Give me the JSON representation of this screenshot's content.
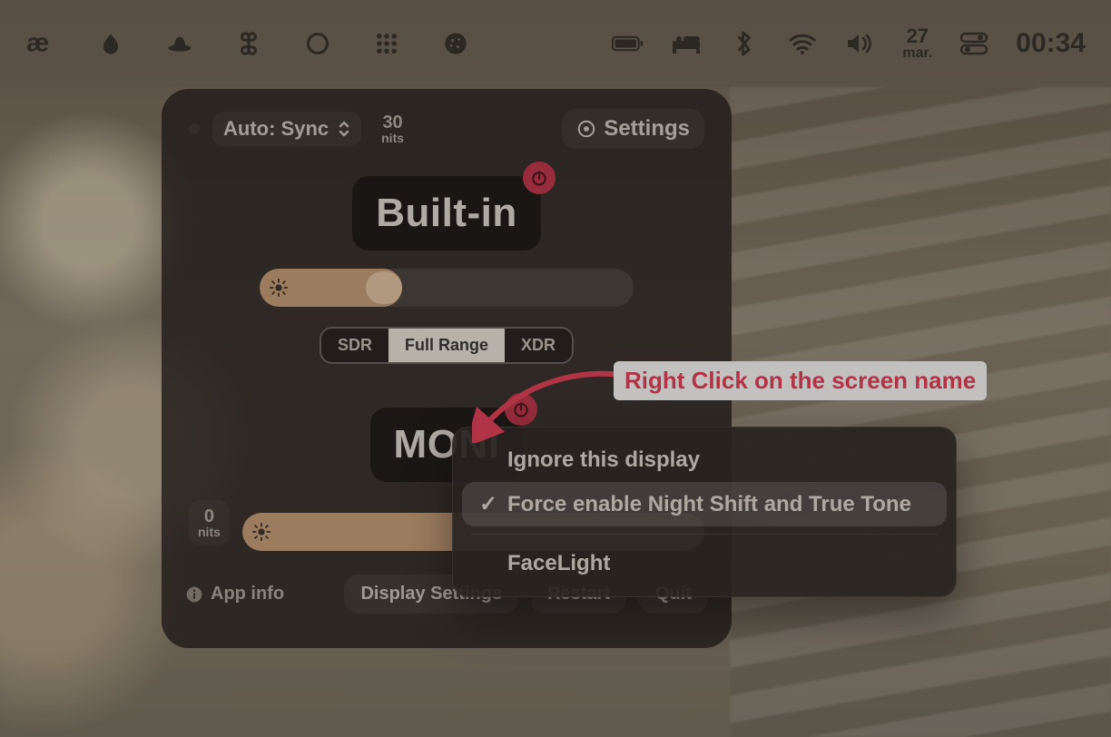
{
  "menubar": {
    "date_day": "27",
    "date_sub": "mar.",
    "time": "00:34"
  },
  "panel": {
    "mode_label": "Auto: Sync",
    "nits_value": "30",
    "nits_unit": "nits",
    "settings_label": "Settings",
    "display1": {
      "name": "Built-in",
      "seg": {
        "a": "SDR",
        "b": "Full Range",
        "c": "XDR"
      },
      "brightness_pct": 38
    },
    "display2": {
      "name": "MONI",
      "nits_value": "0",
      "nits_unit": "nits",
      "brightness_pct": 100
    },
    "footer": {
      "app_info": "App info",
      "display_settings": "Display Settings",
      "restart": "Restart",
      "quit": "Quit"
    }
  },
  "context_menu": {
    "items": [
      {
        "label": "Ignore this display",
        "checked": false
      },
      {
        "label": "Force enable Night Shift and True Tone",
        "checked": true
      },
      {
        "label": "FaceLight",
        "checked": false
      }
    ]
  },
  "annotation": "Right Click on the screen name"
}
